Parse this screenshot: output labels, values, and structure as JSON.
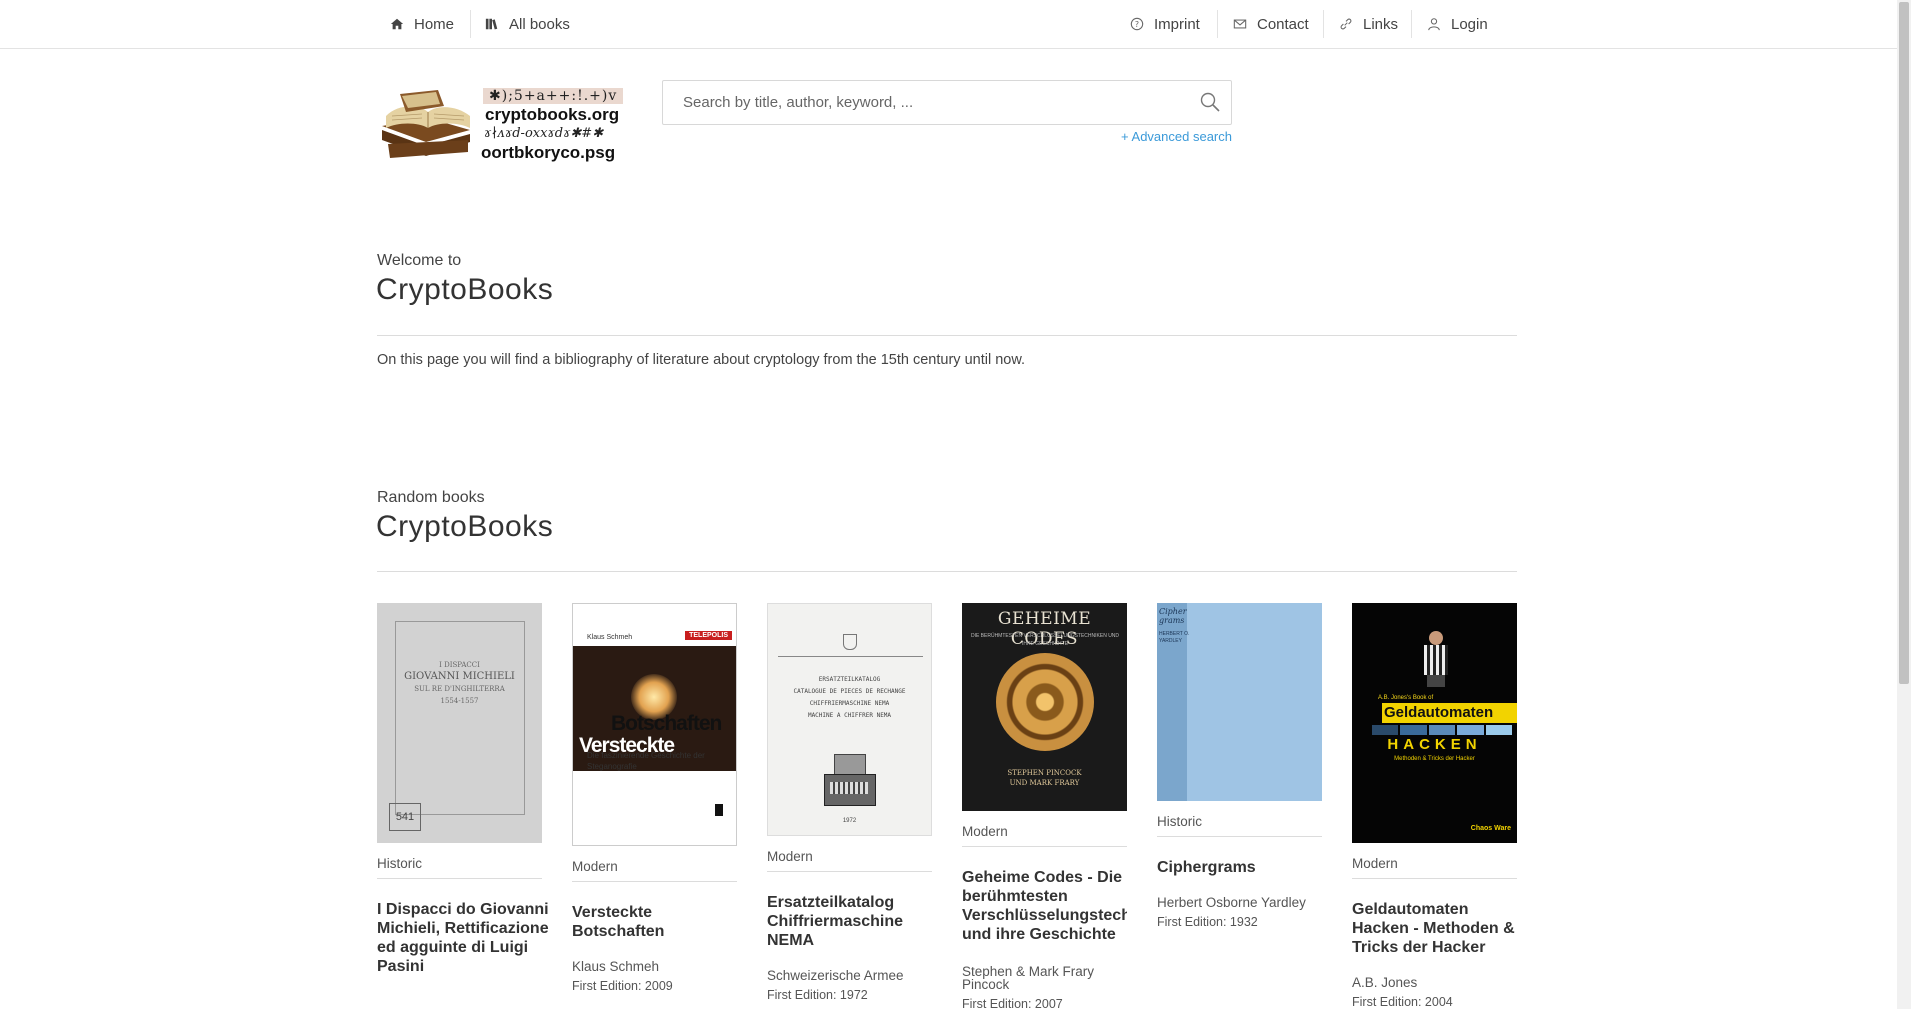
{
  "nav": {
    "home": "Home",
    "all_books": "All books",
    "imprint": "Imprint",
    "contact": "Contact",
    "links": "Links",
    "login": "Login"
  },
  "logo": {
    "cipher_line1": "✱);5+a++:!.+)v",
    "site": "cryptobooks.org",
    "cipher_line2": "ɤ∤ᴧɤd-oxxɤdɤ✱#✱",
    "reversed": "oortbkoryco.psg"
  },
  "search": {
    "placeholder": "Search by title, author, keyword, ...",
    "advanced": "+ Advanced search"
  },
  "welcome": {
    "kicker": "Welcome to",
    "title": "CryptoBooks",
    "text": "On this page you will find a bibliography of literature about cryptology from the 15th century until now."
  },
  "random": {
    "kicker": "Random books",
    "title": "CryptoBooks"
  },
  "books": [
    {
      "category": "Historic",
      "title": "I Dispacci do Giovanni Michieli, Rettificazione ed agguinte di Luigi Pasini",
      "author": "",
      "edition": "",
      "cover": {
        "lines": [
          "I DISPACCI",
          "GIOVANNI MICHIELI",
          "SUL RE D'INGHILTERRA",
          "1554-1557"
        ],
        "stamp": "541"
      }
    },
    {
      "category": "Modern",
      "title": "Versteckte\nBotschaften",
      "author": "Klaus Schmeh",
      "edition": "First Edition: 2009",
      "cover": {
        "author": "Klaus Schmeh",
        "badge": "TELEPOLIS",
        "title1": "Versteckte",
        "title2": "Botschaften",
        "subtitle": "Die faszinierende Geschichte der Steganografie"
      }
    },
    {
      "category": "Modern",
      "title": "Ersatzteilkatalog Chiffriermaschine NEMA",
      "author": "Schweizerische Armee",
      "edition": "First Edition: 1972",
      "cover": {
        "lines": [
          "ERSATZTEILKATALOG",
          "CATALOGUE DE PIECES DE RECHANGE",
          "CHIFFRIERMASCHINE NEMA",
          "MACHINE A CHIFFRER NEMA"
        ],
        "year": "1972"
      }
    },
    {
      "category": "Modern",
      "title": "Geheime Codes - Die berühmtesten Verschlüsselungstechniken und ihre Geschichte",
      "author": "Stephen & Mark Frary\nPincock",
      "edition": "First Edition: 2007",
      "cover": {
        "title": "GEHEIME CODES",
        "subtitle": "DIE BERÜHMTESTEN VERSCHLÜSSELUNGSTECHNIKEN UND IHRE GESCHICHTE",
        "author1": "STEPHEN PINCOCK",
        "author2": "UND MARK FRARY"
      }
    },
    {
      "category": "Historic",
      "title": "Ciphergrams",
      "author": "Herbert Osborne Yardley",
      "edition": "First Edition: 1932",
      "cover": {
        "spine1": "Cipher grams",
        "spine2": "HERBERT O. YARDLEY"
      }
    },
    {
      "category": "Modern",
      "title": "Geldautomaten Hacken - Methoden & Tricks der Hacker",
      "author": "A.B. Jones",
      "edition": "First Edition: 2004",
      "cover": {
        "top": "A.B. Jones's Book of",
        "title1": "Geldautomaten",
        "title2": "HACKEN",
        "subtitle": "Methoden & Tricks der Hacker",
        "publisher": "Chaos Ware"
      }
    }
  ]
}
